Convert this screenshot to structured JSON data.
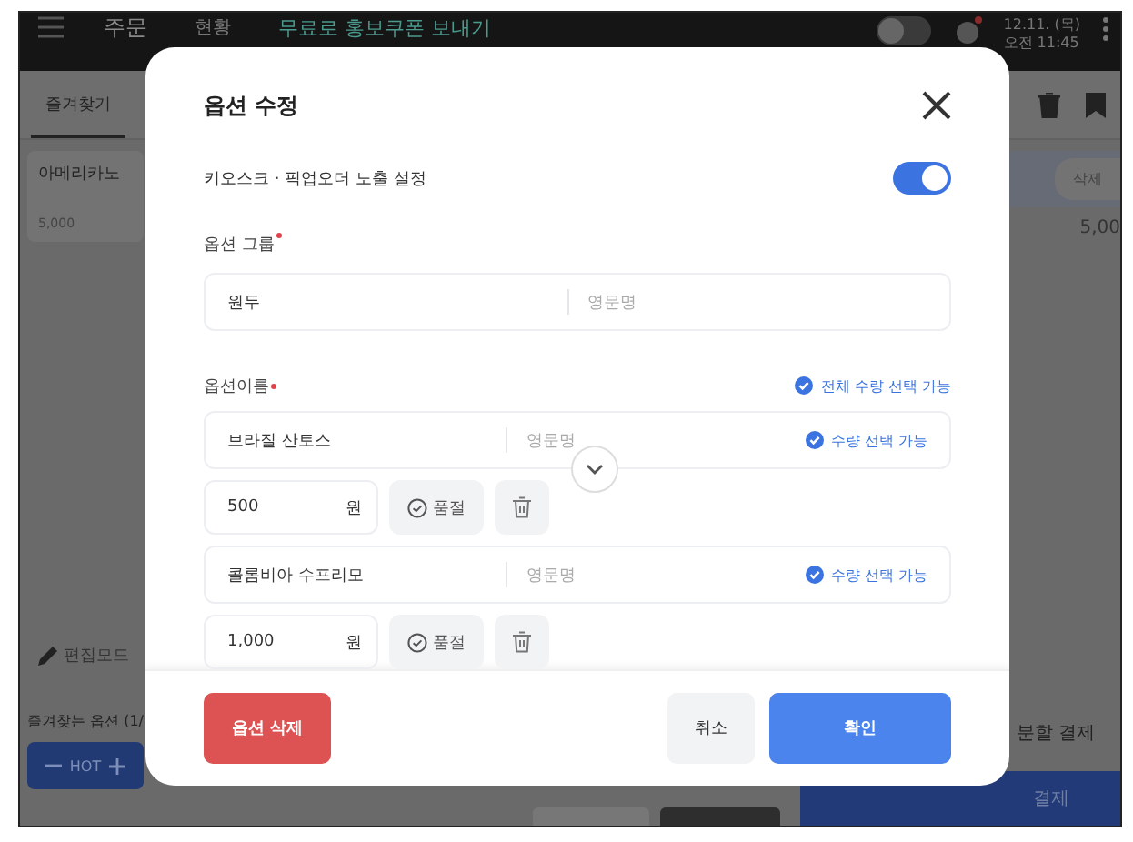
{
  "background": {
    "top_bar": {
      "title": "주문",
      "tab": "현황",
      "promo_link": "무료로 홍보쿠폰 보내기",
      "date": "12.11. (목)",
      "time": "오전 11:45"
    },
    "favorites_tab": {
      "label": "즐겨찾기",
      "selected": true
    },
    "menu_card": {
      "name": "아메리카노",
      "price": "5,000"
    },
    "edit_mode": "편집모드",
    "favorite_options_heading": "즐겨찾는 옵션 (1/",
    "option_chip": "HOT",
    "order_panel": {
      "delete_button": "삭제",
      "amount": "5,00",
      "split_payment": "분할 결제",
      "pay_button": "결제"
    }
  },
  "dialog": {
    "title": "옵션 수정",
    "kiosk_toggle": {
      "label": "키오스크 · 픽업오더 노출 설정",
      "on": true
    },
    "option_group": {
      "label": "옵션 그룹",
      "required": true,
      "value": "원두",
      "english_placeholder": "영문명"
    },
    "option_names": {
      "label": "옵션이름",
      "required": true,
      "all_quantity": {
        "label": "전체 수량 선택 가능",
        "checked": true
      },
      "items": [
        {
          "name": "브라질 산토스",
          "english_placeholder": "영문명",
          "quantity": {
            "label": "수량 선택 가능",
            "checked": true
          },
          "price": "500",
          "unit": "원",
          "sold_out_label": "품절",
          "sold_out": false
        },
        {
          "name": "콜롬비아 수프리모",
          "english_placeholder": "영문명",
          "quantity": {
            "label": "수량 선택 가능",
            "checked": true
          },
          "price": "1,000",
          "unit": "원",
          "sold_out_label": "품절",
          "sold_out": false
        }
      ]
    },
    "buttons": {
      "delete": "옵션 삭제",
      "cancel": "취소",
      "confirm": "확인"
    }
  }
}
